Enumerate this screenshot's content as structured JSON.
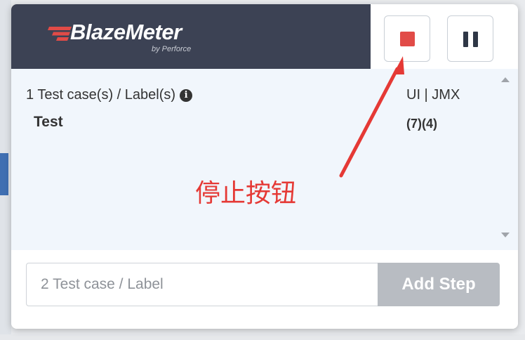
{
  "header": {
    "logo_text": "BlazeMeter",
    "logo_byline": "by Perforce",
    "stop_button": "stop-icon",
    "pause_button": "pause-icon"
  },
  "test_list": {
    "summary": "1 Test case(s) / Label(s)",
    "info_icon": "i",
    "type_label": "UI | JMX",
    "items": [
      {
        "name": "Test",
        "counts": "(7)(4)"
      }
    ]
  },
  "annotation": {
    "text": "停止按钮",
    "color": "#e53935"
  },
  "footer": {
    "input_placeholder": "2 Test case / Label",
    "add_step_label": "Add Step"
  },
  "colors": {
    "header_bg": "#3c4254",
    "stop": "#e14b47",
    "content_bg": "#f1f6fc",
    "add_btn": "#b8bcc2"
  }
}
